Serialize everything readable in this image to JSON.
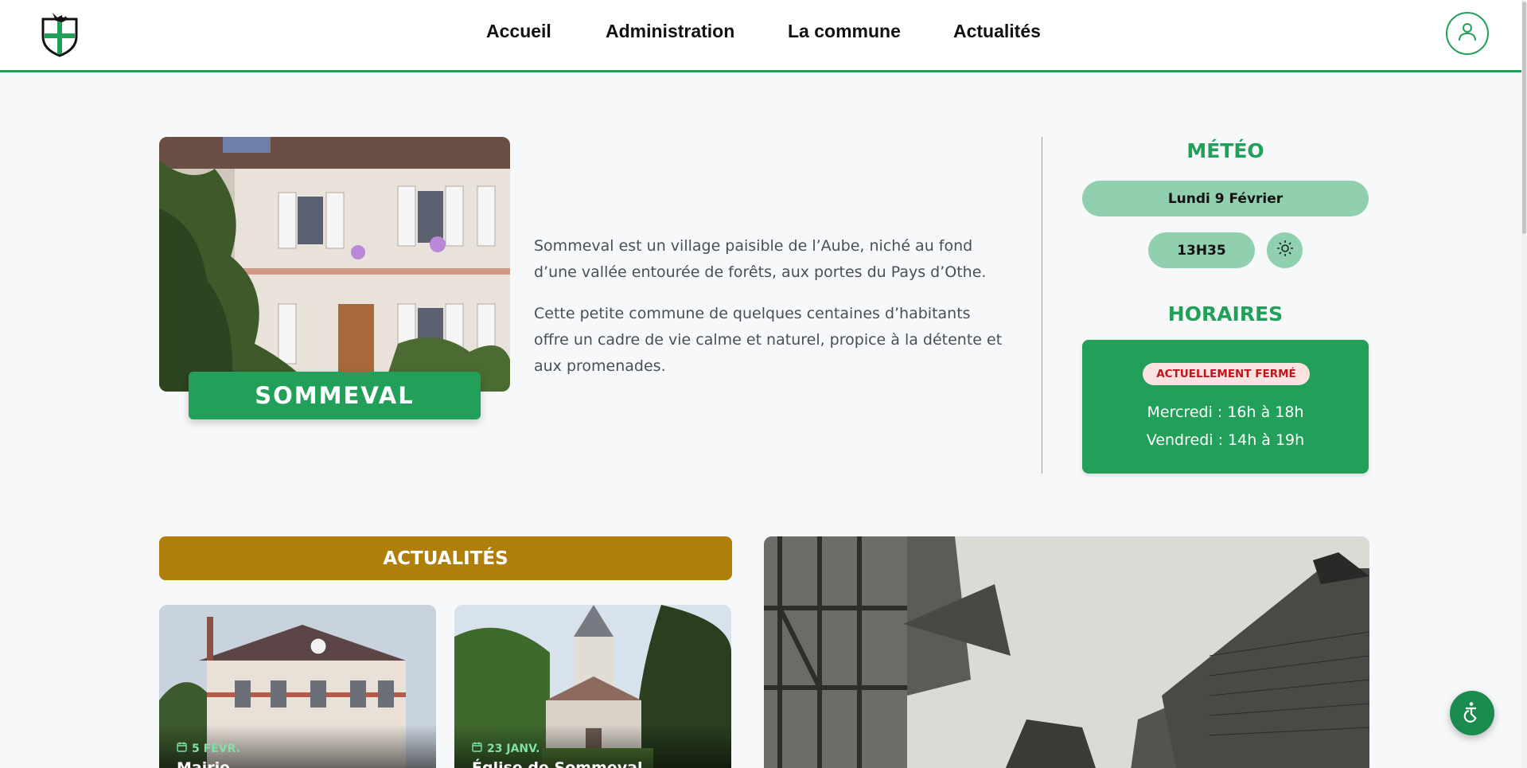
{
  "header": {
    "nav": [
      {
        "label": "Accueil",
        "active": true
      },
      {
        "label": "Administration",
        "active": false
      },
      {
        "label": "La commune",
        "active": false
      },
      {
        "label": "Actualités",
        "active": false
      }
    ],
    "user_icon": "user-icon",
    "accent_color": "#22a05a"
  },
  "hero": {
    "village_name": "SOMMEVAL",
    "intro_paragraphs": [
      "Sommeval est un village paisible de l’Aube, niché au fond d’une vallée entourée de forêts, aux portes du Pays d’Othe.",
      "Cette petite commune de quelques centaines d’habitants offre un cadre de vie calme et naturel, propice à la détente et aux promenades."
    ]
  },
  "meteo": {
    "title": "MÉTÉO",
    "date": "Lundi 9 Février",
    "time": "13H35",
    "weather_icon": "sun-icon"
  },
  "horaires": {
    "title": "HORAIRES",
    "status": "ACTUELLEMENT FERMÉ",
    "lines": [
      "Mercredi : 16h à 18h",
      "Vendredi : 14h à 19h"
    ]
  },
  "news": {
    "title": "ACTUALITÉS",
    "title_color": "#b07f09",
    "items": [
      {
        "date": "5 FÉVR.",
        "title": "Mairie"
      },
      {
        "date": "23 JANV.",
        "title": "Église de Sommeval"
      }
    ]
  },
  "accessibility_icon": "accessibility-icon"
}
